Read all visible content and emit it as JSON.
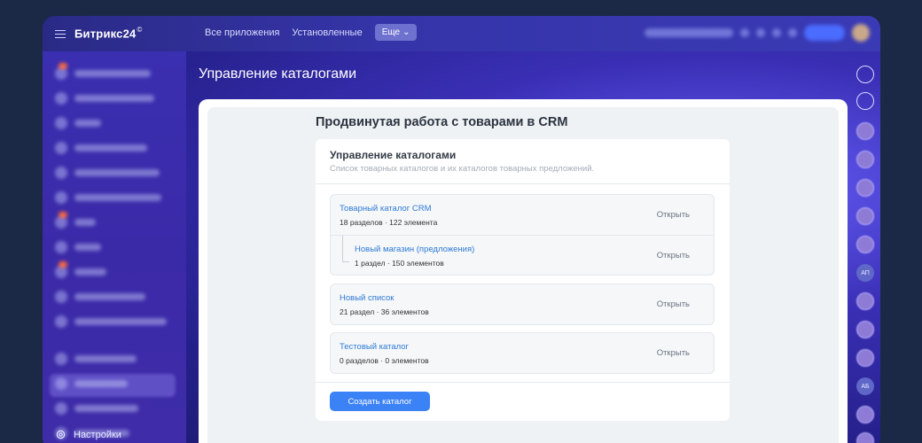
{
  "app": {
    "brand": "Битрикс24",
    "brand_mark": "©"
  },
  "top_nav": {
    "all_apps": "Все приложения",
    "installed": "Установленные",
    "more": "Еще",
    "more_caret": "⌄"
  },
  "page": {
    "title": "Управление каталогами"
  },
  "sidebar": {
    "settings_label": "Настройки"
  },
  "content": {
    "heading": "Продвинутая работа с товарами в CRM",
    "panel_title": "Управление каталогами",
    "panel_subtitle": "Список товарных каталогов и их каталогов товарных предложений.",
    "catalogs": [
      {
        "name": "Товарный каталог CRM",
        "meta": "18 разделов · 122 элемента",
        "action": "Открыть",
        "child": {
          "name": "Новый магазин (предложения)",
          "meta": "1 раздел · 150 элементов",
          "action": "Открыть"
        }
      },
      {
        "name": "Новый список",
        "meta": "21 раздел · 36 элементов",
        "action": "Открыть"
      },
      {
        "name": "Тестовый каталог",
        "meta": "0 разделов · 0 элементов",
        "action": "Открыть"
      }
    ],
    "create_button": "Создать каталог"
  },
  "right_rail": {
    "avatar_initials_1": "АП",
    "avatar_initials_2": "АБ"
  },
  "colors": {
    "accent": "#3b82f6",
    "link": "#2f7ad6",
    "sidebar": "#3a2fb0"
  },
  "icons": {
    "menu": "burger-icon",
    "settings": "gear-icon",
    "notifications": "bell-icon",
    "chat": "chat-icon",
    "more": "chevron-down-icon"
  }
}
